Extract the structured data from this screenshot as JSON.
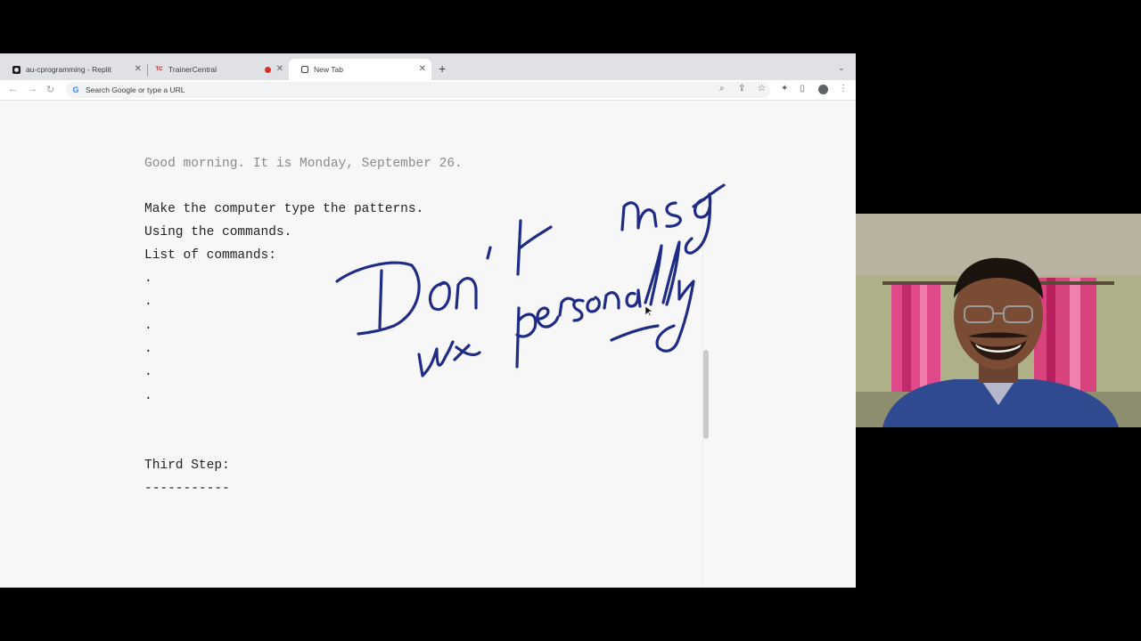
{
  "tabs": [
    {
      "title": "au-cprogramming - Replit",
      "favicon": "replit-icon"
    },
    {
      "title": "TrainerCentral",
      "favicon": "trainercentral-icon",
      "recording": true
    },
    {
      "title": "New Tab",
      "favicon": "newtab-icon",
      "active": true
    }
  ],
  "omnibox": {
    "placeholder": "Search Google or type a URL"
  },
  "document": {
    "greeting": "Good morning. It is Monday, September 26.",
    "line1": "Make the computer type the patterns.",
    "line2": "Using the commands.",
    "line3": "List of commands:",
    "bullets": [
      ".",
      ".",
      ".",
      ".",
      ".",
      "."
    ],
    "step": "Third Step:",
    "divider": "-----------"
  },
  "handwriting": {
    "text": "Don't msg use personally",
    "color": "#1f2c86"
  },
  "colors": {
    "page": "#f7f7f7",
    "tabstrip": "#dfe1e5",
    "ink": "#1f2c86"
  }
}
